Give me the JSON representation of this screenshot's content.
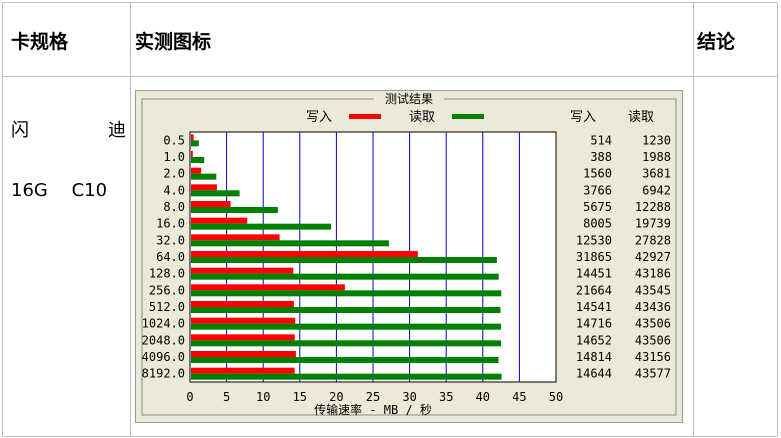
{
  "table": {
    "headers": [
      "卡规格",
      "实测图标",
      "结论"
    ],
    "row": {
      "card_spec": "闪 迪 16G C10",
      "conclusion": ""
    }
  },
  "chart_data": {
    "type": "bar",
    "title": "测试结果",
    "xlabel": "传输速率 - MB / 秒",
    "ylabel": "",
    "xlim": [
      0,
      50
    ],
    "x_ticks": [
      "0",
      "5",
      "10",
      "15",
      "20",
      "25",
      "30",
      "35",
      "40",
      "45",
      "50"
    ],
    "legend": [
      {
        "name": "写入",
        "color": "#ff0000"
      },
      {
        "name": "读取",
        "color": "#008000"
      }
    ],
    "value_headers": [
      "写入",
      "读取"
    ],
    "categories": [
      "0.5",
      "1.0",
      "2.0",
      "4.0",
      "8.0",
      "16.0",
      "32.0",
      "64.0",
      "128.0",
      "256.0",
      "512.0",
      "1024.0",
      "2048.0",
      "4096.0",
      "8192.0"
    ],
    "series": [
      {
        "name": "写入",
        "color": "#ff0000",
        "values": [
          514,
          388,
          1560,
          3766,
          5675,
          8005,
          12530,
          31865,
          14451,
          21664,
          14541,
          14716,
          14652,
          14814,
          14644
        ]
      },
      {
        "name": "读取",
        "color": "#008000",
        "values": [
          1230,
          1988,
          3681,
          6942,
          12288,
          19739,
          27828,
          42927,
          43186,
          43545,
          43436,
          43506,
          43506,
          43156,
          43577
        ]
      }
    ]
  }
}
